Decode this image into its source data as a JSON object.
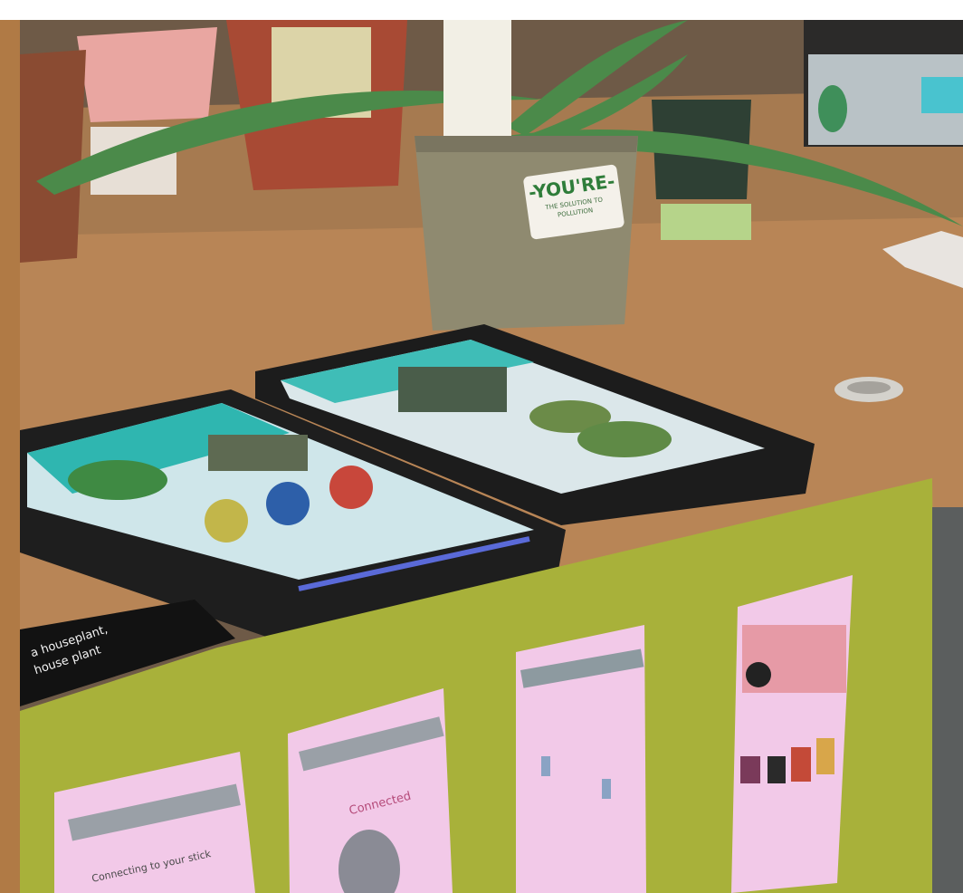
{
  "sticker": {
    "main": "-YOU'RE-",
    "sub": "THE SOLUTION TO POLLUTION"
  },
  "sign": {
    "line1": "a houseplant,",
    "line2": "house plant"
  },
  "phones": [
    {
      "title": "",
      "caption": "Connecting to your stick"
    },
    {
      "title": "Connected",
      "caption": ""
    },
    {
      "title": "",
      "caption": ""
    },
    {
      "title": "",
      "caption": ""
    }
  ]
}
